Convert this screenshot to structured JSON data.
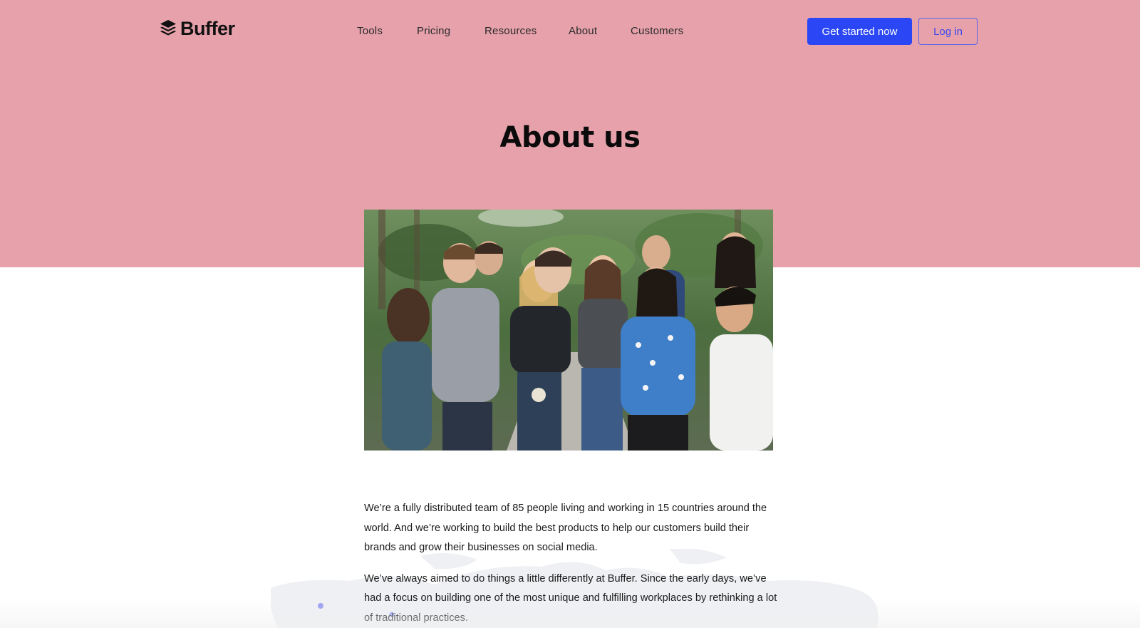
{
  "header": {
    "logo_text": "Buffer",
    "nav": [
      "Tools",
      "Pricing",
      "Resources",
      "About",
      "Customers"
    ],
    "cta_primary": "Get started now",
    "cta_secondary": "Log in"
  },
  "hero": {
    "title": "About us",
    "band_color": "#e6a1ab",
    "photo_icon": "team-photo"
  },
  "content": {
    "paragraphs": [
      "We’re a fully distributed team of 85 people living and working in 15 countries around the world. And we’re working to build the best products to help our customers build their brands and grow their businesses on social media.",
      "We’ve always aimed to do things a little differently at Buffer. Since the early days, we’ve had a focus on building one of the most unique and fulfilling workplaces by rethinking a lot of traditional practices."
    ]
  },
  "colors": {
    "accent": "#2b46f4",
    "outline_button": "#5a64e6",
    "text": "#111111"
  }
}
